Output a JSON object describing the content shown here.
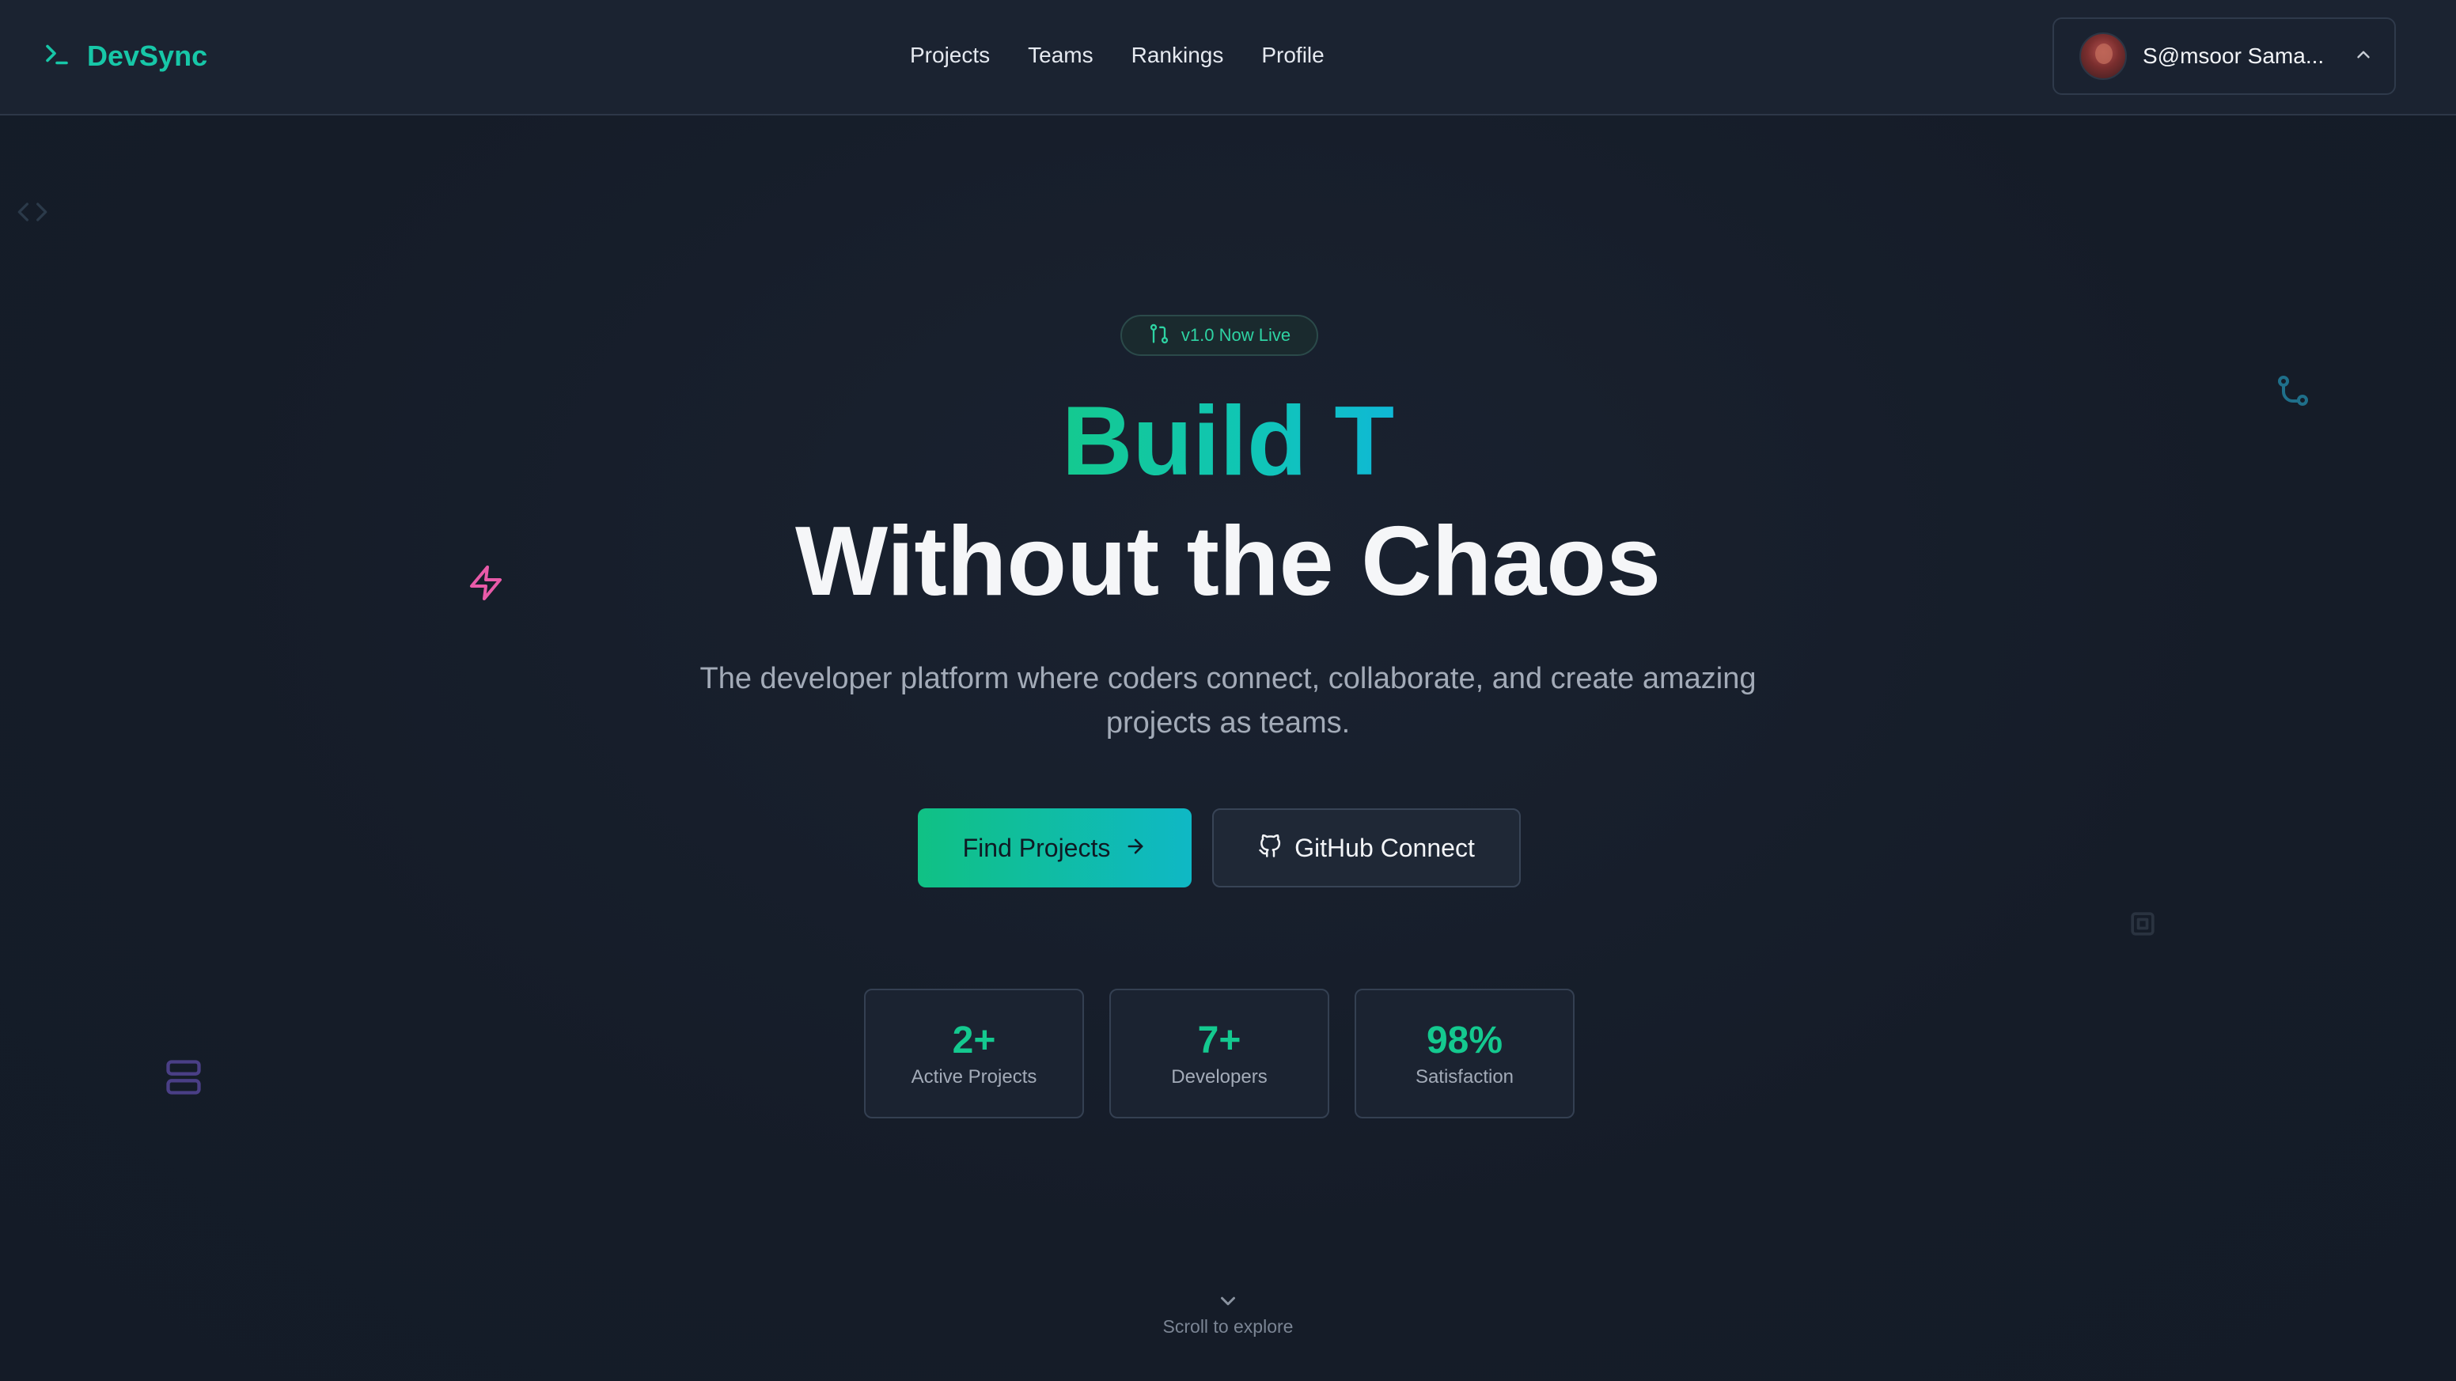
{
  "navbar": {
    "brand": "DevSync",
    "links": [
      {
        "label": "Projects"
      },
      {
        "label": "Teams"
      },
      {
        "label": "Rankings"
      },
      {
        "label": "Profile"
      }
    ],
    "user": {
      "name": "S@msoor Sama..."
    }
  },
  "hero": {
    "badge": "v1.0 Now Live",
    "title_line1": "Build T",
    "title_line2": "Without the Chaos",
    "subtitle": "The developer platform where coders connect, collaborate, and create amazing projects as teams.",
    "primary_cta": "Find Projects",
    "secondary_cta": "GitHub Connect"
  },
  "stats": [
    {
      "value": "2+",
      "label": "Active Projects"
    },
    {
      "value": "7+",
      "label": "Developers"
    },
    {
      "value": "98%",
      "label": "Satisfaction"
    }
  ],
  "scroll_hint": "Scroll to explore",
  "colors": {
    "accent": "#14c98f",
    "accent_alt": "#0fb8d6",
    "background": "#161d2a",
    "deco_pink": "#e85aa8",
    "deco_purple": "#5b4b9a"
  },
  "icons": {
    "brand": "terminal-icon",
    "badge": "git-pull-request-icon",
    "primary_cta": "arrow-right-icon",
    "secondary_cta": "github-icon",
    "user_menu": "chevron-up-icon",
    "scroll": "chevron-down-icon",
    "deco": [
      "code-icon",
      "git-branch-icon",
      "zap-icon",
      "server-icon",
      "cpu-icon"
    ]
  }
}
